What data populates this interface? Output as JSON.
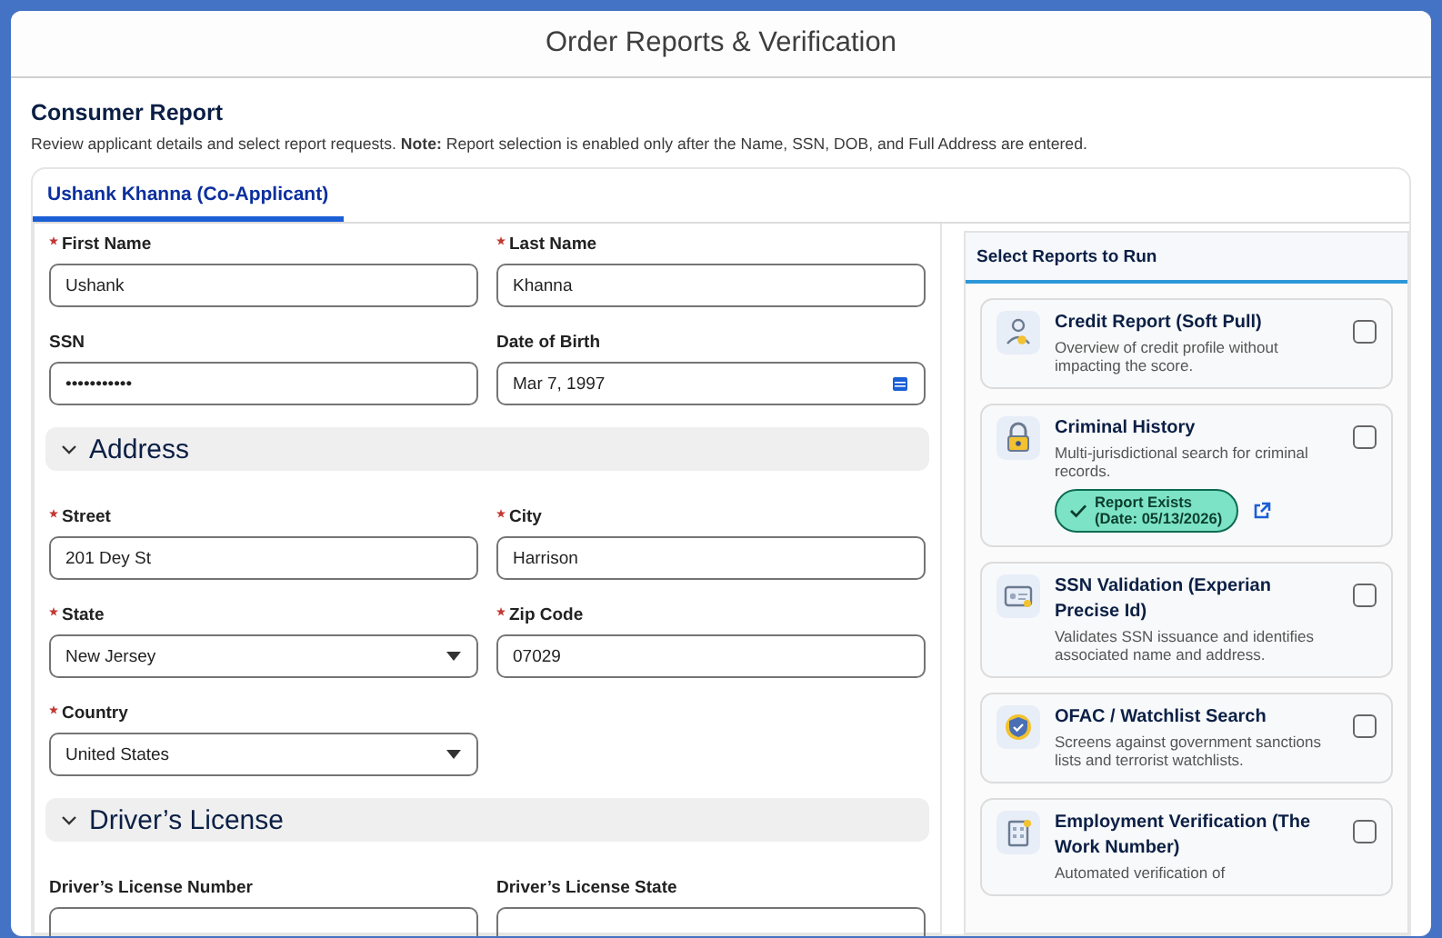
{
  "window": {
    "title": "Order Reports & Verification"
  },
  "section": {
    "title": "Consumer Report",
    "description": "Review applicant details and select report requests. **Note:** Report selection is enabled only after the Name, SSN, DOB, and Full Address are entered."
  },
  "tabs": [
    {
      "label": "Ushank Khanna (Co-Applicant)",
      "selected": true
    }
  ],
  "groups": [
    {
      "fields": [
        {
          "label": "First Name",
          "required": true,
          "kind": "text",
          "value": "Ushank"
        },
        {
          "label": "Last Name",
          "required": true,
          "kind": "text",
          "value": "Khanna"
        },
        {
          "label": "SSN",
          "required": false,
          "kind": "text",
          "value": "•••••••••••"
        },
        {
          "label": "Date of Birth",
          "required": false,
          "kind": "date",
          "value": "Mar 7, 1997"
        }
      ]
    },
    {
      "title": "Address",
      "expanded": true,
      "fields": [
        {
          "label": "Street",
          "required": true,
          "kind": "text",
          "value": "201 Dey St"
        },
        {
          "label": "City",
          "required": true,
          "kind": "text",
          "value": "Harrison"
        },
        {
          "label": "State",
          "required": true,
          "kind": "select",
          "value": "New Jersey"
        },
        {
          "label": "Zip Code",
          "required": true,
          "kind": "text",
          "value": "07029"
        },
        {
          "label": "Country",
          "required": true,
          "kind": "select",
          "value": "United States"
        }
      ]
    },
    {
      "title": "Driver’s License",
      "expanded": true,
      "fields": [
        {
          "label": "Driver’s License Number",
          "required": false,
          "kind": "text"
        },
        {
          "label": "Driver’s License State",
          "required": false,
          "kind": "text"
        }
      ]
    }
  ],
  "reports_panel": {
    "title": "Select Reports to Run",
    "reports": [
      {
        "title": "Credit Report (Soft Pull)",
        "description": "Overview of credit profile without impacting the score.",
        "checked": false
      },
      {
        "title": "Criminal History",
        "description": "Multi-jurisdictional search for criminal records.",
        "checked": false,
        "badge": {
          "lines": [
            "Report Exists",
            "(Date: 05/13/2026)"
          ]
        }
      },
      {
        "title": "SSN Validation (Experian Precise Id)",
        "description": "Validates SSN issuance and identifies associated name and address.",
        "checked": false
      },
      {
        "title": "OFAC / Watchlist Search",
        "description": "Screens against government sanctions lists and terrorist watchlists.",
        "checked": false
      },
      {
        "title": "Employment Verification (The Work Number)",
        "description": "Automated verification of",
        "checked": false
      }
    ]
  }
}
